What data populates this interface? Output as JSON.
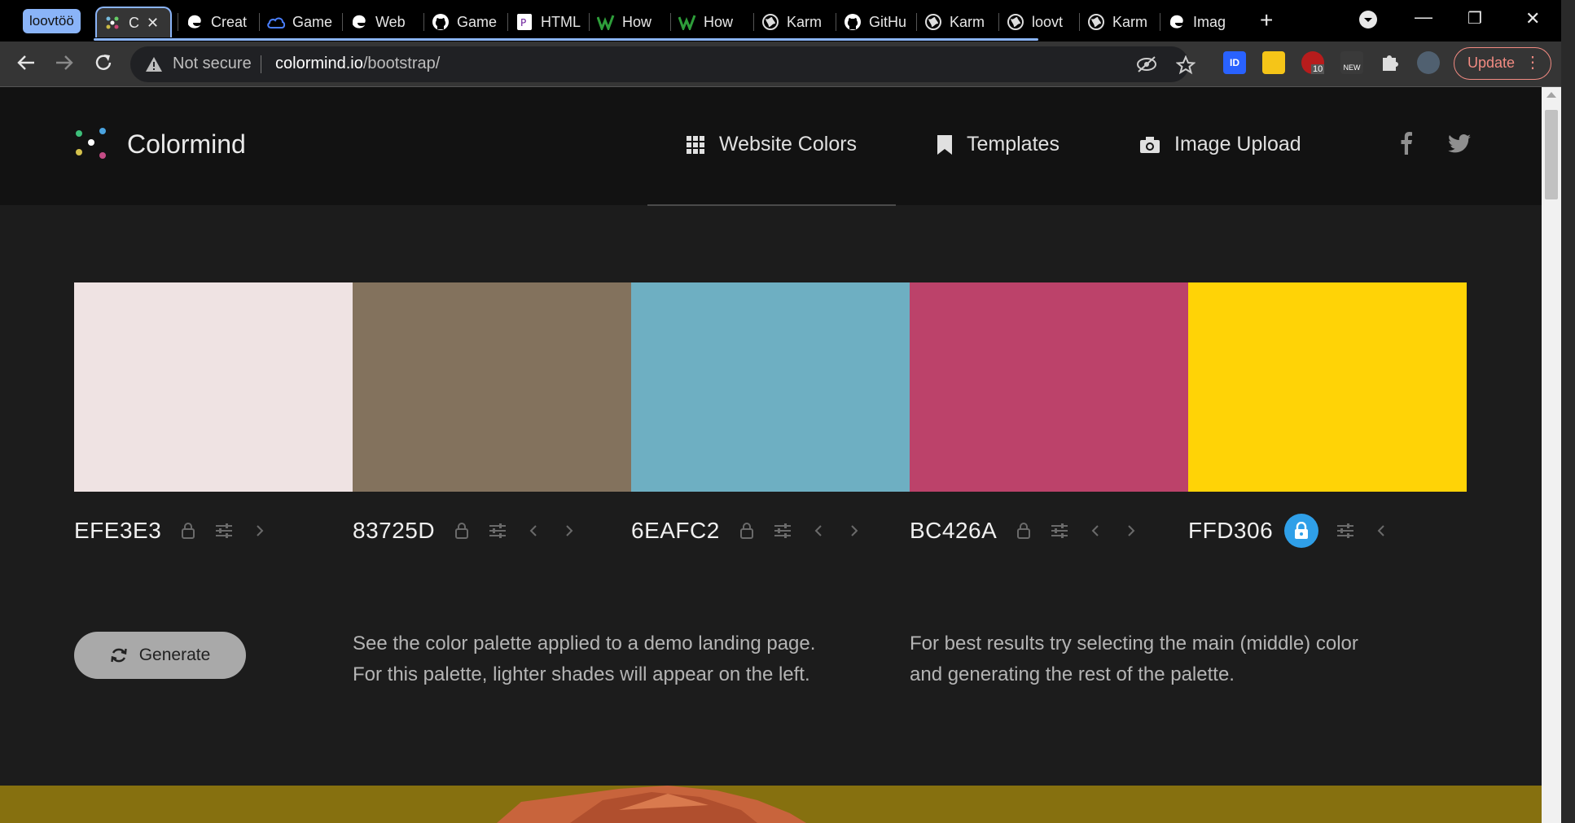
{
  "browser": {
    "tab_group_label": "loovtöö",
    "active_tab_title": "C",
    "tabs": [
      "Creat",
      "Game",
      "Web",
      "Game",
      "HTML",
      "How",
      "How",
      "Karm",
      "GitHu",
      "Karm",
      "loovt",
      "Karm",
      "Imag"
    ],
    "new_tab": "+",
    "window_minimize": "—",
    "window_restore": "❐",
    "window_close": "✕",
    "omnibox": {
      "security": "Not secure",
      "domain": "colormind.io",
      "path": "/bootstrap/"
    },
    "update_label": "Update",
    "extension_badge": "10",
    "extension_new": "NEW",
    "extension_tag": "ID"
  },
  "site": {
    "brand": "Colormind",
    "nav": {
      "website_colors": "Website Colors",
      "templates": "Templates",
      "image_upload": "Image Upload"
    }
  },
  "palette": [
    {
      "hex": "EFE3E3",
      "color": "#EFE3E3",
      "locked": false,
      "prev": false,
      "next": true
    },
    {
      "hex": "83725D",
      "color": "#83725D",
      "locked": false,
      "prev": true,
      "next": true
    },
    {
      "hex": "6EAFC2",
      "color": "#6EAFC2",
      "locked": false,
      "prev": true,
      "next": true
    },
    {
      "hex": "BC426A",
      "color": "#BC426A",
      "locked": false,
      "prev": true,
      "next": true
    },
    {
      "hex": "FFD306",
      "color": "#FFD306",
      "locked": true,
      "prev": true,
      "next": false
    }
  ],
  "generate_label": "Generate",
  "desc_left": [
    "See the color palette applied to a demo landing page.",
    "For this palette, lighter shades will appear on the left."
  ],
  "desc_right": [
    "For best results try selecting the main (middle) color",
    "and generating the rest of the palette."
  ],
  "colors": {
    "accent": "#2f9fe8",
    "tab_highlight": "#8ab4f8",
    "update": "#f28b82"
  }
}
